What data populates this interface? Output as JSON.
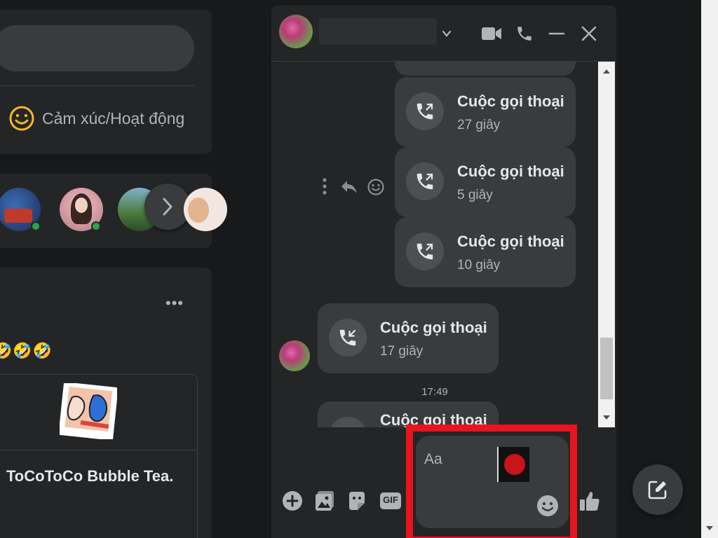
{
  "feed": {
    "feeling_label": "Cảm xúc/Hoạt động",
    "post_more": "•••",
    "post_emojis": "🤣🤣🤣",
    "link_title": "ToCoToCo Bubble Tea."
  },
  "chat": {
    "messages": [
      {
        "title": "Cuộc gọi thoại",
        "duration": "27 giây",
        "direction": "outgoing"
      },
      {
        "title": "Cuộc gọi thoại",
        "duration": "5 giây",
        "direction": "outgoing"
      },
      {
        "title": "Cuộc gọi thoại",
        "duration": "10 giây",
        "direction": "outgoing"
      },
      {
        "title": "Cuộc gọi thoại",
        "duration": "17 giây",
        "direction": "incoming"
      },
      {
        "title": "Cuộc gọi thoại",
        "duration": "",
        "direction": "incoming"
      }
    ],
    "timestamp": "17:49",
    "composer": {
      "placeholder": "Aa",
      "gif_label": "GIF"
    }
  },
  "colors": {
    "accent_highlight": "#e8141e",
    "online": "#31a24c",
    "bubble": "#3a3b3c",
    "emoji_yellow": "#f7b928"
  },
  "icons": [
    "smile-icon",
    "chevron-right-icon",
    "chevron-down-icon",
    "video-call-icon",
    "phone-icon",
    "minimize-icon",
    "close-icon",
    "phone-outgoing-icon",
    "phone-incoming-icon",
    "more-vertical-icon",
    "reply-icon",
    "plus-icon",
    "image-icon",
    "sticker-icon",
    "gif-icon",
    "like-icon",
    "compose-icon"
  ]
}
